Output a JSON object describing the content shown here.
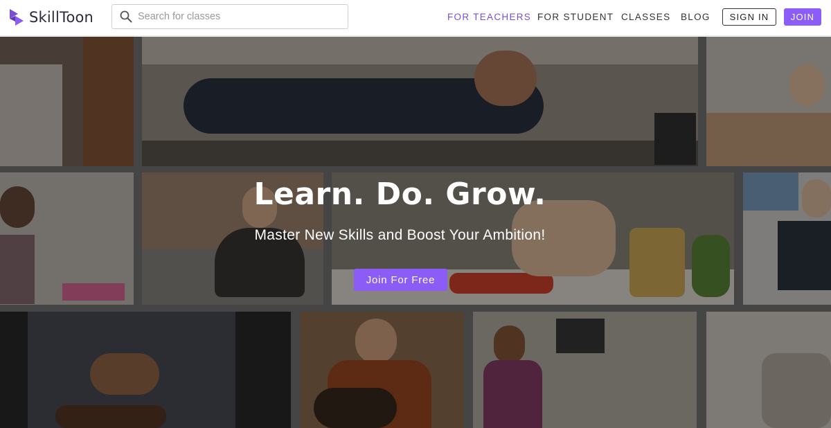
{
  "brand": {
    "name": "SkillToon",
    "accent_color": "#8b5cf6"
  },
  "search": {
    "placeholder": "Search for classes",
    "value": "",
    "icon": "search-icon"
  },
  "nav": {
    "items": [
      {
        "label": "FOR TEACHERS",
        "active": true
      },
      {
        "label": "FOR STUDENT"
      },
      {
        "label": "CLASSES"
      },
      {
        "label": "BLOG"
      }
    ],
    "signin_label": "SIGN IN",
    "join_label": "JOIN"
  },
  "hero": {
    "title": "Learn. Do. Grow.",
    "subtitle": "Master New Skills and Boost Your Ambition!",
    "cta_label": "Join For Free"
  }
}
